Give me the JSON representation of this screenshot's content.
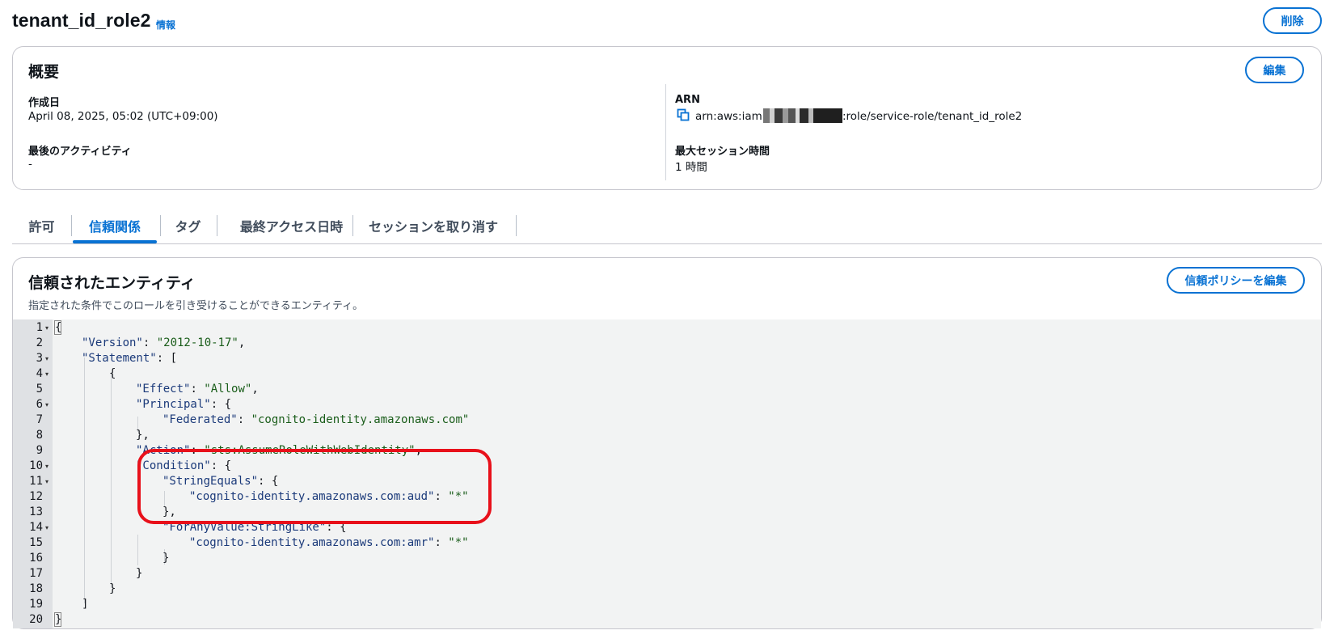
{
  "header": {
    "title": "tenant_id_role2",
    "info_link": "情報",
    "delete_button": "削除"
  },
  "summary": {
    "title": "概要",
    "edit_button": "編集",
    "created_label": "作成日",
    "created_value": "April 08, 2025, 05:02 (UTC+09:00)",
    "last_activity_label": "最後のアクティビティ",
    "last_activity_value": "-",
    "arn_label": "ARN",
    "arn_prefix": "arn:aws:iam::",
    "arn_suffix": ":role/service-role/tenant_id_role2",
    "max_session_label": "最大セッション時間",
    "max_session_value": "1 時間"
  },
  "tabs": [
    {
      "label": "許可",
      "active": false
    },
    {
      "label": "信頼関係",
      "active": true
    },
    {
      "label": "タグ",
      "active": false
    },
    {
      "label": "最終アクセス日時",
      "active": false
    },
    {
      "label": "セッションを取り消す",
      "active": false
    }
  ],
  "trust": {
    "title": "信頼されたエンティティ",
    "description": "指定された条件でこのロールを引き受けることができるエンティティ。",
    "edit_button": "信頼ポリシーを編集"
  },
  "code_lines": [
    {
      "n": "1",
      "fold": true
    },
    {
      "n": "2",
      "fold": false
    },
    {
      "n": "3",
      "fold": true
    },
    {
      "n": "4",
      "fold": true
    },
    {
      "n": "5",
      "fold": false
    },
    {
      "n": "6",
      "fold": true
    },
    {
      "n": "7",
      "fold": false
    },
    {
      "n": "8",
      "fold": false
    },
    {
      "n": "9",
      "fold": false
    },
    {
      "n": "10",
      "fold": true
    },
    {
      "n": "11",
      "fold": true
    },
    {
      "n": "12",
      "fold": false
    },
    {
      "n": "13",
      "fold": false
    },
    {
      "n": "14",
      "fold": true
    },
    {
      "n": "15",
      "fold": false
    },
    {
      "n": "16",
      "fold": false
    },
    {
      "n": "17",
      "fold": false
    },
    {
      "n": "18",
      "fold": false
    },
    {
      "n": "19",
      "fold": false
    },
    {
      "n": "20",
      "fold": false
    }
  ],
  "policy": {
    "open_brace": "{",
    "version_key": "\"Version\"",
    "version_value": "\"2012-10-17\"",
    "statement_key": "\"Statement\"",
    "effect_key": "\"Effect\"",
    "effect_value": "\"Allow\"",
    "principal_key": "\"Principal\"",
    "federated_key": "\"Federated\"",
    "federated_value": "\"cognito-identity.amazonaws.com\"",
    "action_key": "\"Action\"",
    "action_value": "\"sts:AssumeRoleWithWebIdentity\"",
    "condition_key": "\"Condition\"",
    "string_equals_key": "\"StringEquals\"",
    "aud_key": "\"cognito-identity.amazonaws.com:aud\"",
    "aud_value": "\"*\"",
    "foranyvalue_key": "\"ForAnyValue:StringLike\"",
    "amr_key": "\"cognito-identity.amazonaws.com:amr\"",
    "amr_value": "\"*\"",
    "close_brace": "}"
  },
  "colors": {
    "accent": "#0972d3",
    "highlight": "#e8101a"
  },
  "icons": {
    "copy": "copy-icon"
  }
}
